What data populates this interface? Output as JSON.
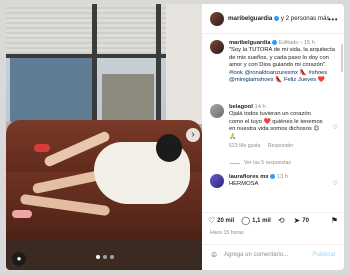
{
  "header": {
    "username": "maribelguardia",
    "suffix": "y 2 personas más",
    "more": "•••"
  },
  "caption": {
    "username": "maribelguardia",
    "edited": "Editado",
    "age": "15 h",
    "text": "\"Soy la TUTORA de mi vida, la arquitecta de mis sueños, y cada paso lo doy con amor y con Dios guiando mi corazón\".",
    "tags": "#look @ronaldoanzuresmx 👠 #shoes @minigiamshoes 👠 Feliz Jueves ❤️"
  },
  "comments": [
    {
      "username": "belagool",
      "age": "14 h",
      "text": "Ojalá todos tuvieran un corazón como el tuyo ❤️ quiénes le tenemos en nuestra vida somos dichosos 😊🙏",
      "likes": "623 Me gusta",
      "reply": "Responder",
      "view_replies": "Ver las 5 respuestas"
    },
    {
      "username": "lauraflores_mx",
      "username_display": "lauraflores mx",
      "age": "13 h",
      "text": "HERMOSA"
    }
  ],
  "actions": {
    "likes": "20 mil",
    "comments": "1,1 mil",
    "shares": "70"
  },
  "timestamp": "Hace 15 horas",
  "add_comment": {
    "placeholder": "Agrega un comentario...",
    "post": "Publicar"
  },
  "photo": {
    "tag_icon": "person-icon",
    "next": "›",
    "carousel_total": 3,
    "carousel_active": 1
  }
}
